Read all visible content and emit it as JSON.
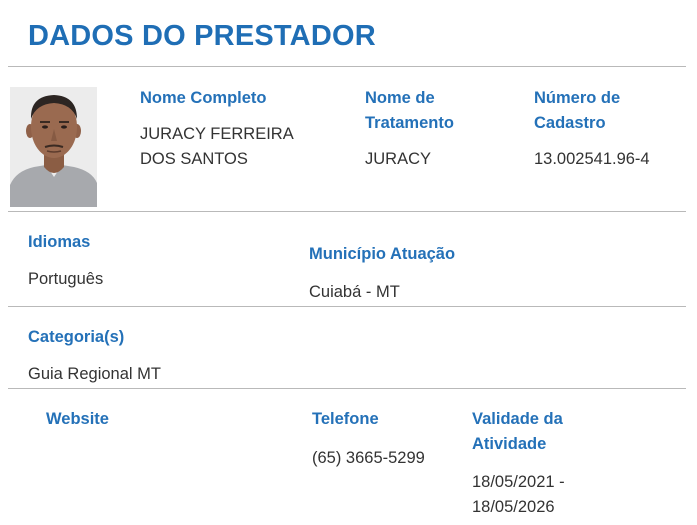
{
  "header": {
    "title": "DADOS DO PRESTADOR"
  },
  "profile": {
    "photo_alt": "Foto do prestador",
    "nome_completo_label": "Nome Completo",
    "nome_completo_line1": "JURACY FERREIRA",
    "nome_completo_line2": "DOS SANTOS",
    "nome_tratamento_label_line1": "Nome de",
    "nome_tratamento_label_line2": "Tratamento",
    "nome_tratamento_value": "JURACY",
    "numero_cadastro_label_line1": "Número de",
    "numero_cadastro_label_line2": "Cadastro",
    "numero_cadastro_value": "13.002541.96-4"
  },
  "languages": {
    "label": "Idiomas",
    "value": "Português"
  },
  "municipality": {
    "label": "Município Atuação",
    "value": "Cuiabá - MT"
  },
  "categories": {
    "label": "Categoria(s)",
    "value": "Guia Regional MT"
  },
  "contact": {
    "website_label": "Website",
    "telefone_label": "Telefone",
    "telefone_value": "(65) 3665-5299",
    "validade_label_line1": "Validade da",
    "validade_label_line2": "Atividade",
    "validade_value_line1": "18/05/2021 -",
    "validade_value_line2": "18/05/2026"
  },
  "colors": {
    "title": "#1f6eb5",
    "label": "#2471b8",
    "text": "#333333",
    "divider": "#b9b9b9"
  }
}
